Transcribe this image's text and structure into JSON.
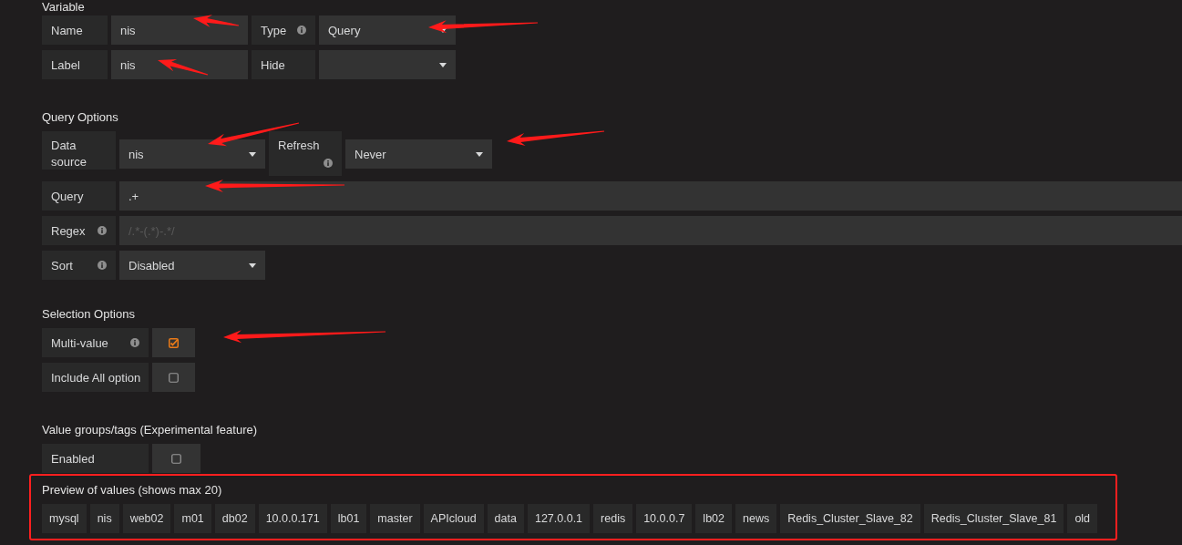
{
  "sections": [
    {
      "title": "Variable",
      "rows": [
        {
          "fields": [
            {
              "kind": "label",
              "text": "Name",
              "info": false
            },
            {
              "kind": "input",
              "value": "nis"
            },
            {
              "kind": "label",
              "text": "Type",
              "info": true
            },
            {
              "kind": "select",
              "value": "Query"
            }
          ]
        },
        {
          "fields": [
            {
              "kind": "label",
              "text": "Label",
              "info": false
            },
            {
              "kind": "input",
              "value": "nis"
            },
            {
              "kind": "label",
              "text": "Hide",
              "info": false
            },
            {
              "kind": "select"
            }
          ]
        }
      ]
    },
    {
      "title": "Query Options",
      "rows": [
        {
          "fields": [
            {
              "kind": "label",
              "text": "Data source",
              "info": false
            },
            {
              "kind": "select",
              "value": "nis"
            },
            {
              "kind": "label",
              "text": "Refresh",
              "info": true
            },
            {
              "kind": "select",
              "value": "Never"
            }
          ]
        },
        {
          "fields": [
            {
              "kind": "label",
              "text": "Query",
              "info": false
            },
            {
              "kind": "input",
              "value": ".+"
            }
          ]
        },
        {
          "fields": [
            {
              "kind": "label",
              "text": "Regex",
              "info": true
            },
            {
              "kind": "input",
              "placeholder": "/.*-(.*)-.*/"
            }
          ]
        },
        {
          "fields": [
            {
              "kind": "label",
              "text": "Sort",
              "info": true
            },
            {
              "kind": "select",
              "value": "Disabled"
            }
          ]
        }
      ]
    },
    {
      "title": "Selection Options",
      "rows": [
        {
          "fields": [
            {
              "kind": "label",
              "text": "Multi-value",
              "info": true
            },
            {
              "kind": "checkbox",
              "checked": true
            }
          ]
        },
        {
          "fields": [
            {
              "kind": "label",
              "text": "Include All option",
              "info": false
            },
            {
              "kind": "checkbox",
              "checked": false
            }
          ]
        }
      ]
    },
    {
      "title": "Value groups/tags (Experimental feature)",
      "rows": [
        {
          "fields": [
            {
              "kind": "label",
              "text": "Enabled",
              "info": false
            },
            {
              "kind": "checkbox",
              "checked": false
            }
          ]
        }
      ]
    }
  ],
  "preview": {
    "title": "Preview of values (shows max 20)",
    "values": [
      "mysql",
      "nis",
      "web02",
      "m01",
      "db02",
      "10.0.0.171",
      "lb01",
      "master",
      "APIcloud",
      "data",
      "127.0.0.1",
      "redis",
      "10.0.0.7",
      "lb02",
      "news",
      "Redis_Cluster_Slave_82",
      "Redis_Cluster_Slave_81",
      "old"
    ]
  }
}
